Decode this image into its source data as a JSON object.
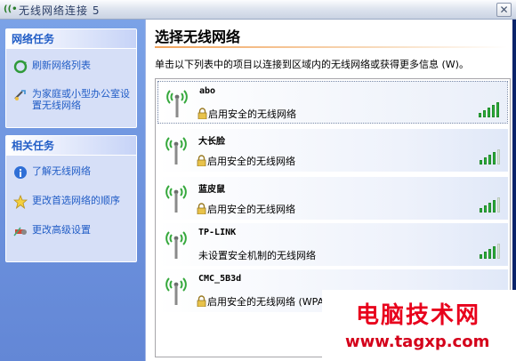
{
  "window": {
    "title": "无线网络连接 5",
    "close_glyph": "✕"
  },
  "sidebar": {
    "network_tasks": {
      "title": "网络任务",
      "items": [
        {
          "label": "刷新网络列表",
          "icon": "refresh-icon"
        },
        {
          "label": "为家庭或小型办公室设置无线网络",
          "icon": "setup-wizard-icon"
        }
      ]
    },
    "related_tasks": {
      "title": "相关任务",
      "items": [
        {
          "label": "了解无线网络",
          "icon": "info-icon"
        },
        {
          "label": "更改首选网络的顺序",
          "icon": "star-icon"
        },
        {
          "label": "更改高级设置",
          "icon": "settings-icon"
        }
      ]
    }
  },
  "content": {
    "title": "选择无线网络",
    "description": "单击以下列表中的项目以连接到区域内的无线网络或获得更多信息 (W)。",
    "networks": [
      {
        "ssid": "abo",
        "security": "启用安全的无线网络",
        "secured": true,
        "signal_bars": 5
      },
      {
        "ssid": "大长脸",
        "security": "启用安全的无线网络",
        "secured": true,
        "signal_bars": 4
      },
      {
        "ssid": "蓝皮鼠",
        "security": "启用安全的无线网络",
        "secured": true,
        "signal_bars": 4
      },
      {
        "ssid": "TP-LINK",
        "security": "未设置安全机制的无线网络",
        "secured": false,
        "signal_bars": 4
      },
      {
        "ssid": "CMC_5B3d",
        "security": "启用安全的无线网络 (WPA)",
        "secured": true,
        "signal_bars": 3
      }
    ]
  },
  "watermark": {
    "cn": "电脑技术网",
    "url": "www.tagxp.com"
  },
  "colors": {
    "sidebar_bg": "#6b90dc",
    "link_blue": "#215dc6",
    "signal_green": "#2db53b",
    "rule_orange": "#f2a35b",
    "watermark_red": "#e8001c"
  }
}
